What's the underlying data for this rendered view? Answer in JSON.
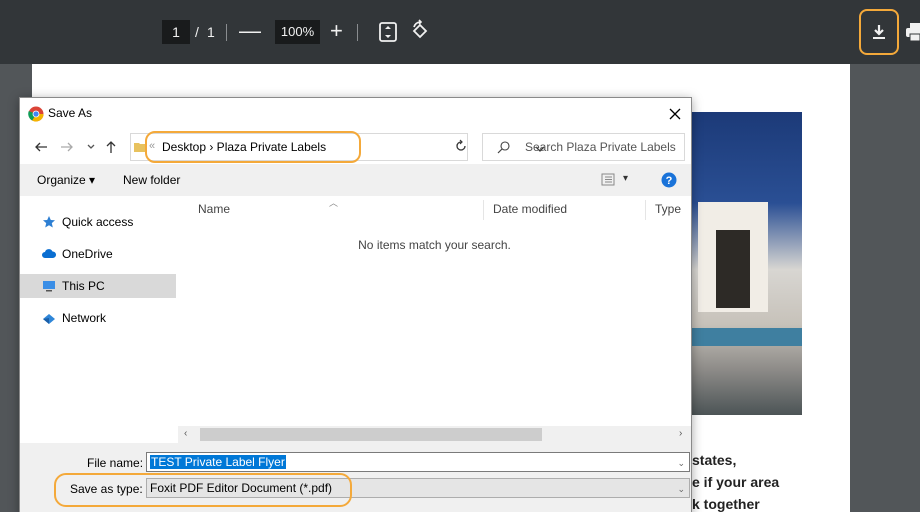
{
  "viewer": {
    "page_current": "1",
    "page_sep": "/",
    "page_total": "1",
    "zoom_out": "—",
    "zoom_level": "100%",
    "zoom_in": "+",
    "accent_color": "#f4a93a"
  },
  "pdf_text": {
    "line1": "states,",
    "line2": "e if your area",
    "line3": "k together"
  },
  "dialog": {
    "title": "Save As",
    "breadcrumb": {
      "prefix": "«",
      "path": "Desktop  ›  Plaza Private Labels"
    },
    "search_placeholder": "Search Plaza Private Labels",
    "organize": "Organize ▾",
    "new_folder": "New folder",
    "view_dropdown": "▾",
    "nav": [
      {
        "label": "Quick access",
        "icon": "star-icon"
      },
      {
        "label": "OneDrive",
        "icon": "cloud-icon"
      },
      {
        "label": "This PC",
        "icon": "computer-icon"
      },
      {
        "label": "Network",
        "icon": "network-icon"
      }
    ],
    "columns": [
      "Name",
      "Date modified",
      "Type"
    ],
    "empty_message": "No items match your search.",
    "file_name_label": "File name:",
    "file_name_value": "TEST Private Label Flyer",
    "save_type_label": "Save as type:",
    "save_type_value": "Foxit PDF Editor Document (*.pdf)"
  }
}
